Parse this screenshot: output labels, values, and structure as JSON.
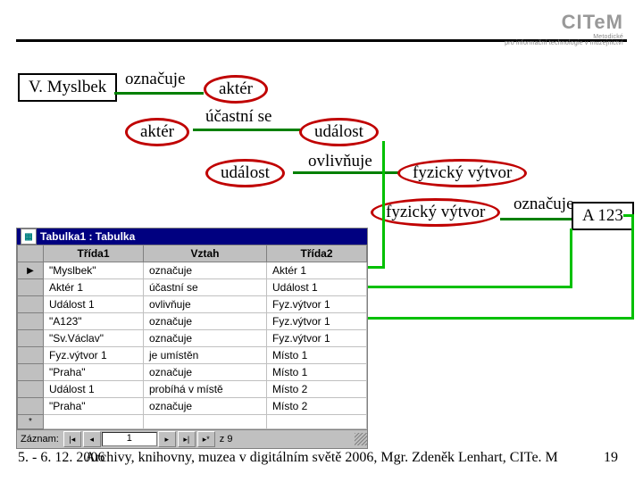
{
  "logo": {
    "name": "CITeM",
    "subtitle_line1": "Metodické",
    "subtitle_line2": "pro informační technologie v muzejnictví"
  },
  "diagram": {
    "n1": "V. Myslbek",
    "r1": "označuje",
    "n2": "aktér",
    "n3": "aktér",
    "r2": "účastní se",
    "n4": "událost",
    "n5": "událost",
    "r3": "ovlivňuje",
    "n6": "fyzický výtvor",
    "n7": "fyzický výtvor",
    "r4": "označuje",
    "n8": "A 123"
  },
  "table": {
    "title": "Tabulka1 : Tabulka",
    "columns": [
      "Třída1",
      "Vztah",
      "Třída2"
    ],
    "rows": [
      {
        "c1": "\"Myslbek\"",
        "c2": "označuje",
        "c3": "Aktér 1",
        "current": true
      },
      {
        "c1": "Aktér 1",
        "c2": "účastní se",
        "c3": "Událost 1"
      },
      {
        "c1": "Událost 1",
        "c2": "ovlivňuje",
        "c3": "Fyz.výtvor 1"
      },
      {
        "c1": "\"A123\"",
        "c2": "označuje",
        "c3": "Fyz.výtvor 1"
      },
      {
        "c1": "\"Sv.Václav\"",
        "c2": "označuje",
        "c3": "Fyz.výtvor 1"
      },
      {
        "c1": "Fyz.výtvor 1",
        "c2": "je umístěn",
        "c3": "Místo 1"
      },
      {
        "c1": "\"Praha\"",
        "c2": "označuje",
        "c3": "Místo 1"
      },
      {
        "c1": "Událost 1",
        "c2": "probíhá v místě",
        "c3": "Místo 2"
      },
      {
        "c1": "\"Praha\"",
        "c2": "označuje",
        "c3": "Místo 2"
      }
    ],
    "record_label": "Záznam:",
    "record_pos": "1",
    "record_of": "z  9",
    "nav": {
      "first": "|◂",
      "prev": "◂",
      "next": "▸",
      "last": "▸|",
      "new": "▸*"
    }
  },
  "footer": {
    "left": "5. - 6. 12. 2006",
    "center": "Archivy, knihovny, muzea v digitálním světě 2006, Mgr. Zdeněk Lenhart, CITe. M",
    "right": "19"
  }
}
